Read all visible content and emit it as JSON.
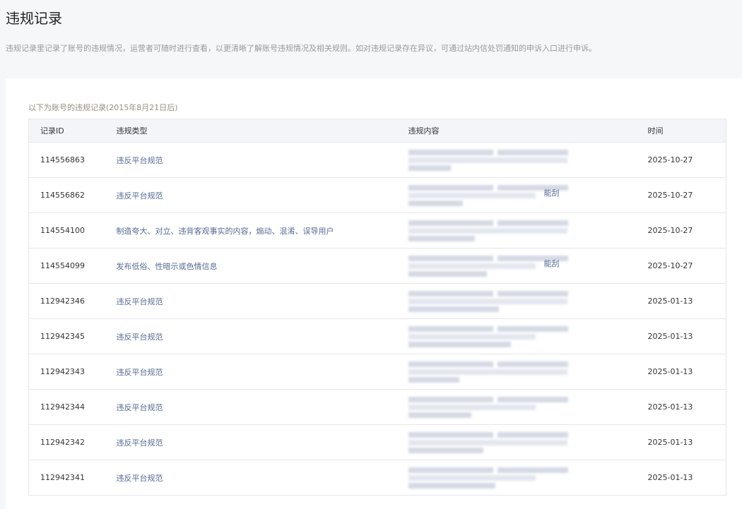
{
  "page": {
    "title": "违规记录",
    "description": "违规记录里记录了账号的违规情况，运营者可随时进行查看，以更清晰了解账号违规情况及相关规则。如对违规记录存在异议，可通过站内信处罚通知的申诉入口进行申诉。"
  },
  "card": {
    "subtitle": "以下为账号的违规记录(2015年8月21日后)"
  },
  "table": {
    "headers": [
      "记录ID",
      "违规类型",
      "违规内容",
      "时间"
    ],
    "rows": [
      {
        "id": "114556863",
        "type": "违反平台规范",
        "content_visible": "",
        "time": "2025-10-27"
      },
      {
        "id": "114556862",
        "type": "违反平台规范",
        "content_visible": "能刮",
        "time": "2025-10-27"
      },
      {
        "id": "114554100",
        "type": "制造夸大、对立、违背客观事实的内容，煽动、混淆、误导用户",
        "content_visible": "",
        "time": "2025-10-27"
      },
      {
        "id": "114554099",
        "type": "发布低俗、性暗示或色情信息",
        "content_visible": "能刮",
        "time": "2025-10-27"
      },
      {
        "id": "112942346",
        "type": "违反平台规范",
        "content_visible": "",
        "time": "2025-01-13"
      },
      {
        "id": "112942345",
        "type": "违反平台规范",
        "content_visible": "",
        "time": "2025-01-13"
      },
      {
        "id": "112942343",
        "type": "违反平台规范",
        "content_visible": "",
        "time": "2025-01-13"
      },
      {
        "id": "112942344",
        "type": "违反平台规范",
        "content_visible": "",
        "time": "2025-01-13"
      },
      {
        "id": "112942342",
        "type": "违反平台规范",
        "content_visible": "",
        "time": "2025-01-13"
      },
      {
        "id": "112942341",
        "type": "违反平台规范",
        "content_visible": "",
        "time": "2025-01-13"
      }
    ]
  }
}
